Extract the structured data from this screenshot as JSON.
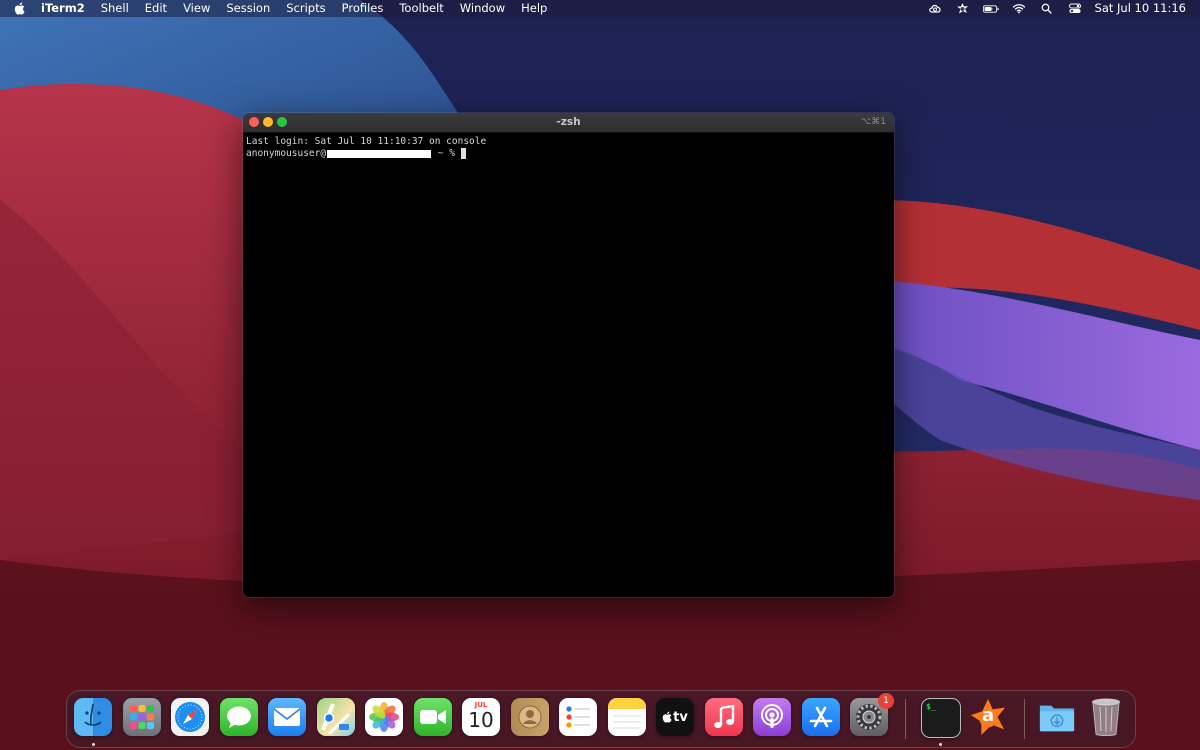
{
  "menubar": {
    "apple_icon": "apple-icon",
    "app_name": "iTerm2",
    "menus": [
      "Shell",
      "Edit",
      "View",
      "Session",
      "Scripts",
      "Profiles",
      "Toolbelt",
      "Window",
      "Help"
    ],
    "status_icons": [
      "creative-cloud-icon",
      "avast-status-icon",
      "battery-icon",
      "wifi-icon",
      "spotlight-search-icon",
      "control-center-icon"
    ],
    "clock": "Sat Jul 10  11:16"
  },
  "terminal": {
    "title": "-zsh",
    "shortcut": "⌥⌘1",
    "last_login": "Last login: Sat Jul 10 11:10:37 on console",
    "prompt_user": "anonymoususer@",
    "prompt_suffix": " ~ % "
  },
  "dock": {
    "calendar": {
      "month": "JUL",
      "day": "10"
    },
    "appletv_label": "tv",
    "settings_badge": "1",
    "terminal_glyph": "$_",
    "avast_glyph": "a",
    "items": [
      "finder-icon",
      "launchpad-icon",
      "safari-icon",
      "messages-icon",
      "mail-icon",
      "maps-icon",
      "photos-icon",
      "facetime-icon",
      "calendar-icon",
      "contacts-icon",
      "reminders-icon",
      "notes-icon",
      "appletv-icon",
      "music-icon",
      "podcasts-icon",
      "appstore-icon",
      "system-preferences-icon",
      "iterm-icon",
      "avast-icon",
      "downloads-folder-icon",
      "trash-icon"
    ]
  },
  "colors": {
    "close": "#fe5f57",
    "minimize": "#febc2e",
    "zoom": "#28c840",
    "badge": "#e8413a"
  }
}
